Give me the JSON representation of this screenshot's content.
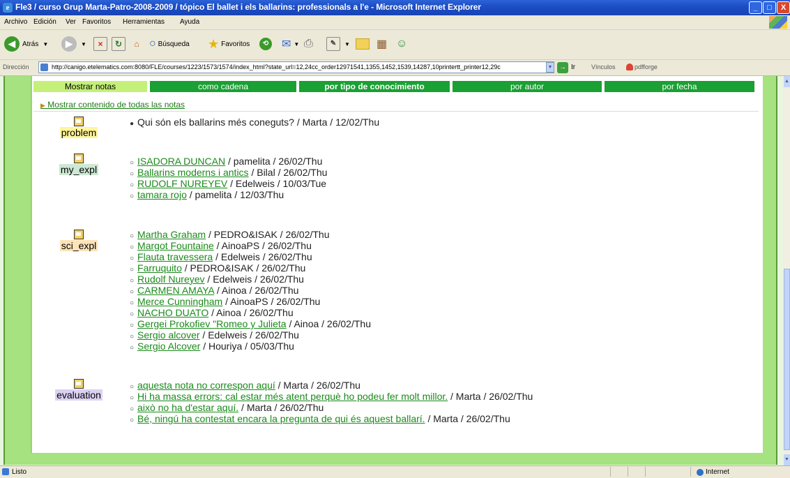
{
  "window": {
    "title": "Fle3 / curso Grup Marta-Patro-2008-2009 / tópico El ballet i els ballarins: professionals a l'e - Microsoft Internet Explorer",
    "minimize": "_",
    "maximize": "□",
    "close": "X"
  },
  "menu": [
    "Archivo",
    "Edición",
    "Ver",
    "Favoritos",
    "Herramientas",
    "Ayuda"
  ],
  "toolbar": {
    "back": "Atrás",
    "search": "Búsqueda",
    "favorites": "Favoritos"
  },
  "address": {
    "label": "Dirección",
    "url": "http://canigo.etelematics.com:8080/FLE/courses/1223/1573/1574/index_html?state_url=12,24cc_order12971541,1355,1452,1539,14287,10printertt_printer12,29c",
    "go": "Ir",
    "links": "Vínculos",
    "pdfforge": "pdfforge"
  },
  "tabs": [
    {
      "label": "Mostrar notas"
    },
    {
      "label": "como cadena"
    },
    {
      "label": "por tipo de conocimiento"
    },
    {
      "label": "por autor"
    },
    {
      "label": "por fecha"
    }
  ],
  "show_all": "Mostrar contenido de todas las notas",
  "groups": [
    {
      "label": "problem",
      "notes": [
        {
          "title": "Qui són els ballarins més coneguts?",
          "meta": " / Marta / 12/02/Thu",
          "link": false
        }
      ]
    },
    {
      "label": "my_expl",
      "notes": [
        {
          "title": "ISADORA DUNCAN",
          "meta": " / pamelita / 26/02/Thu",
          "link": true
        },
        {
          "title": "Ballarins moderns i antics",
          "meta": " / Bilal / 26/02/Thu",
          "link": true
        },
        {
          "title": "RUDOLF NUREYEV",
          "meta": " / Edelweis / 10/03/Tue",
          "link": true
        },
        {
          "title": "tamara rojo",
          "meta": " / pamelita / 12/03/Thu",
          "link": true
        }
      ]
    },
    {
      "label": "sci_expl",
      "notes": [
        {
          "title": "Martha Graham",
          "meta": " / PEDRO&ISAK / 26/02/Thu",
          "link": true
        },
        {
          "title": "Margot Fountaine",
          "meta": " / AinoaPS / 26/02/Thu",
          "link": true
        },
        {
          "title": "Flauta travessera",
          "meta": " / Edelweis / 26/02/Thu",
          "link": true
        },
        {
          "title": "Farruquito",
          "meta": " / PEDRO&ISAK / 26/02/Thu",
          "link": true
        },
        {
          "title": "Rudolf Nureyev",
          "meta": " / Edelweis / 26/02/Thu",
          "link": true
        },
        {
          "title": "CARMEN AMAYA",
          "meta": " / Ainoa / 26/02/Thu",
          "link": true
        },
        {
          "title": "Merce Cunningham",
          "meta": " / AinoaPS / 26/02/Thu",
          "link": true
        },
        {
          "title": "NACHO DUATO",
          "meta": " / Ainoa / 26/02/Thu",
          "link": true
        },
        {
          "title": "Gergei Prokofiev \"Romeo y Julieta",
          "meta": " / Ainoa / 26/02/Thu",
          "link": true
        },
        {
          "title": "Sergio alcover",
          "meta": " / Edelweis / 26/02/Thu",
          "link": true
        },
        {
          "title": "Sergio Alcover",
          "meta": " / Houriya / 05/03/Thu",
          "link": true
        }
      ]
    },
    {
      "label": "evaluation",
      "notes": [
        {
          "title": "aquesta nota no correspon aquí",
          "meta": " / Marta / 26/02/Thu",
          "link": true
        },
        {
          "title": "Hi ha massa errors: cal estar més atent perquè ho podeu fer molt millor.",
          "meta": " / Marta / 26/02/Thu",
          "link": true
        },
        {
          "title": "això no ha d'estar aquí.",
          "meta": " / Marta / 26/02/Thu",
          "link": true
        },
        {
          "title": "Bé, ningú ha contestat encara la pregunta de qui és aquest ballarí.",
          "meta": " / Marta / 26/02/Thu",
          "link": true
        }
      ]
    }
  ],
  "status": {
    "text": "Listo",
    "zone": "Internet"
  }
}
